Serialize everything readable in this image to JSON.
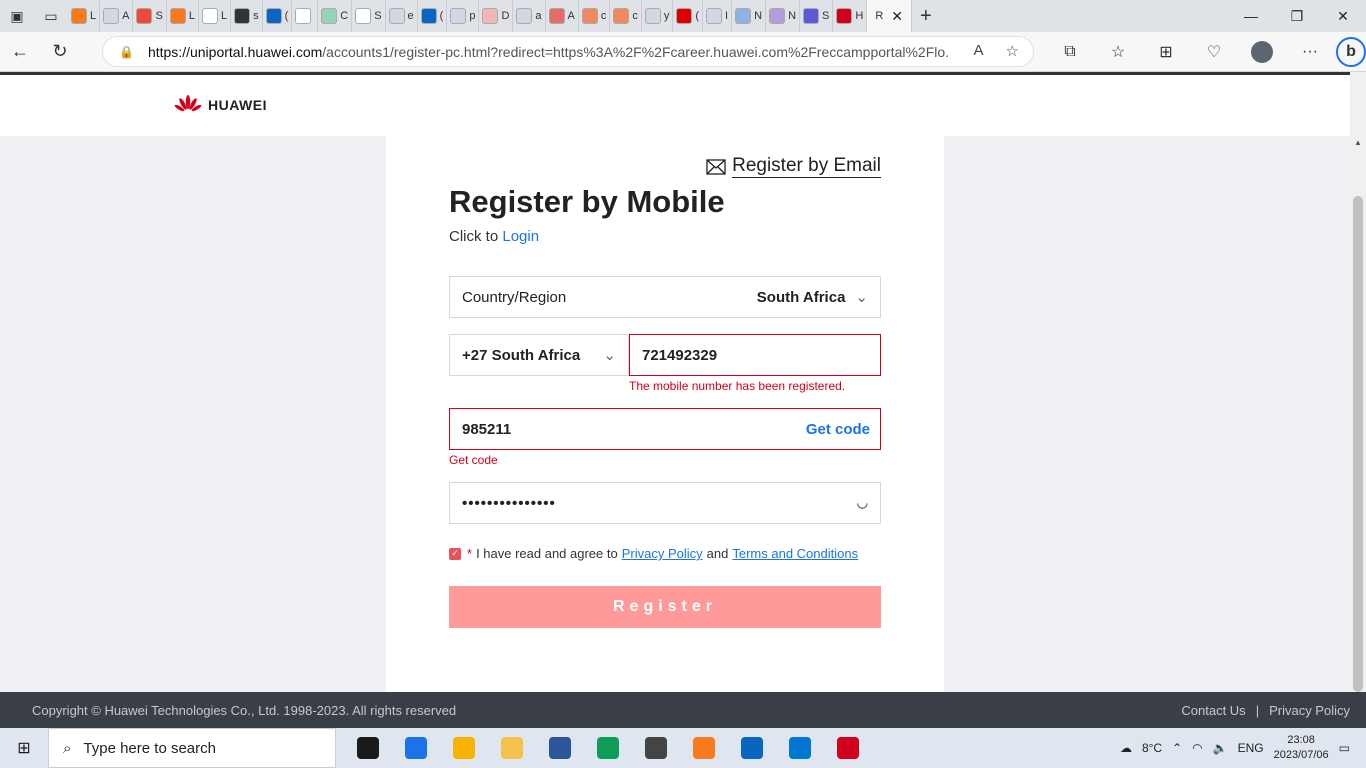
{
  "browser": {
    "tabs": [
      {
        "label": "L",
        "color": "#f97a1c"
      },
      {
        "label": "A",
        "color": "#cfd8e3"
      },
      {
        "label": "S",
        "color": "#e84c3d"
      },
      {
        "label": "L",
        "color": "#f97a1c"
      },
      {
        "label": "L",
        "color": "#ffffff"
      },
      {
        "label": "s",
        "color": "#333333"
      },
      {
        "label": "(",
        "color": "#0a66c2"
      },
      {
        "label": "",
        "color": "#ffffff"
      },
      {
        "label": "C",
        "color": "#9ad1b7"
      },
      {
        "label": "S",
        "color": "#ffffff"
      },
      {
        "label": "e",
        "color": "#cfd8e3"
      },
      {
        "label": "(",
        "color": "#0a66c2"
      },
      {
        "label": "p",
        "color": "#cfd8e3"
      },
      {
        "label": "D",
        "color": "#f2b6b6"
      },
      {
        "label": "a",
        "color": "#cfd8e3"
      },
      {
        "label": "A",
        "color": "#e86a6a"
      },
      {
        "label": "c",
        "color": "#f08a5d"
      },
      {
        "label": "c",
        "color": "#f08a5d"
      },
      {
        "label": "y",
        "color": "#cfd8e3"
      },
      {
        "label": "(",
        "color": "#e00000"
      },
      {
        "label": "I",
        "color": "#cfd8e3"
      },
      {
        "label": "N",
        "color": "#8fb3e0"
      },
      {
        "label": "N",
        "color": "#b39ddb"
      },
      {
        "label": "S",
        "color": "#5b5bd6"
      },
      {
        "label": "H",
        "color": "#d0021b"
      }
    ],
    "active_tab": {
      "label": "R"
    },
    "url_host": "https://uniportal.huawei.com",
    "url_path": "/accounts1/register-pc.html?redirect=https%3A%2F%2Fcareer.huawei.com%2Freccampportal%2Flo..."
  },
  "page": {
    "logo_text": "HUAWEI",
    "register_by_email": "Register by Email",
    "title": "Register by Mobile",
    "click_to": "Click to",
    "login_link": "Login",
    "country_label": "Country/Region",
    "country_value": "South Africa",
    "phone_code": "+27 South Africa",
    "phone_number": "721492329",
    "phone_error": "The mobile number has been registered.",
    "sms_code": "985211",
    "get_code_button": "Get code",
    "sms_error": "Get code",
    "password_mask": "•••••••••••••••",
    "agree_text": "I have read and agree to",
    "privacy_link": "Privacy Policy",
    "and_text": "and",
    "terms_link": "Terms and Conditions",
    "register_button": "Register"
  },
  "footer": {
    "copyright": "Copyright © Huawei Technologies Co., Ltd. 1998-2023. All rights reserved",
    "contact": "Contact Us",
    "separator": "|",
    "privacy": "Privacy Policy"
  },
  "taskbar": {
    "search_placeholder": "Type here to search",
    "apps": [
      {
        "name": "task-view",
        "color": "#1b1b1b"
      },
      {
        "name": "mail",
        "color": "#1a73e8"
      },
      {
        "name": "chrome",
        "color": "#f4b400"
      },
      {
        "name": "file-explorer",
        "color": "#f2c14e"
      },
      {
        "name": "word-like",
        "color": "#2b579a"
      },
      {
        "name": "edge",
        "color": "#0f9d58"
      },
      {
        "name": "chatgpt",
        "color": "#444444"
      },
      {
        "name": "xampp",
        "color": "#f97a1c"
      },
      {
        "name": "outlook",
        "color": "#0a64c2"
      },
      {
        "name": "vscode",
        "color": "#0078d4"
      },
      {
        "name": "wps",
        "color": "#d0021b"
      }
    ],
    "weather": "8°C",
    "language": "ENG",
    "time": "23:08",
    "date": "2023/07/06"
  }
}
